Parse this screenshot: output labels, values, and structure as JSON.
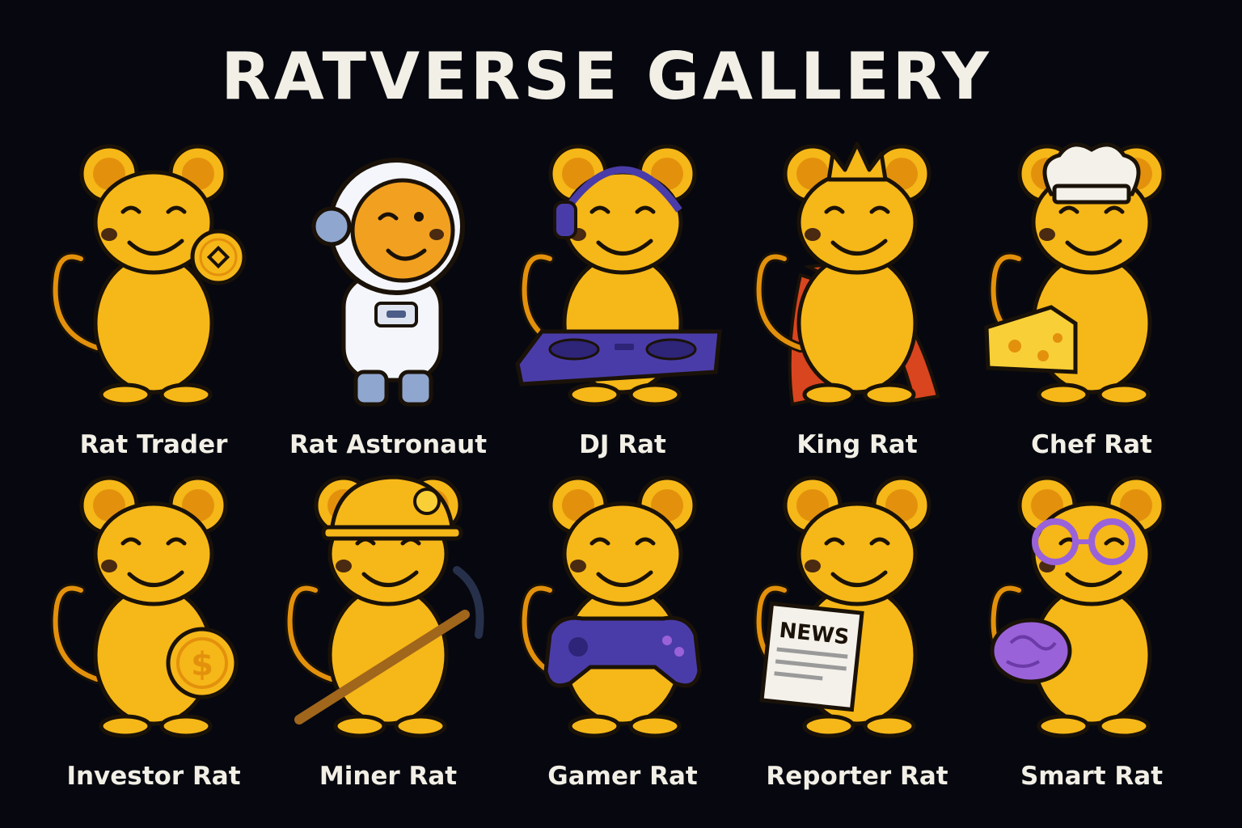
{
  "gallery": {
    "title": "RATVERSE GALLERY",
    "colors": {
      "background": "#07080f",
      "fur": "#f6b718",
      "fur_dark": "#e3910c",
      "outline": "#1a1208",
      "text": "#f2efe6",
      "purple": "#4a3ca8",
      "violet": "#9a62d8",
      "cape": "#d9451f"
    },
    "characters": [
      {
        "name": "Rat Trader",
        "icon": "coin-token-icon"
      },
      {
        "name": "Rat Astronaut",
        "icon": "astronaut-suit-icon"
      },
      {
        "name": "DJ Rat",
        "icon": "dj-turntable-icon"
      },
      {
        "name": "King Rat",
        "icon": "crown-icon"
      },
      {
        "name": "Chef Rat",
        "icon": "chef-hat-cheese-icon"
      },
      {
        "name": "Investor Rat",
        "icon": "dollar-coin-icon"
      },
      {
        "name": "Miner Rat",
        "icon": "pickaxe-helmet-icon"
      },
      {
        "name": "Gamer Rat",
        "icon": "gamepad-icon"
      },
      {
        "name": "Reporter Rat",
        "icon": "newspaper-icon"
      },
      {
        "name": "Smart Rat",
        "icon": "brain-glasses-icon"
      }
    ],
    "newspaper_text": "NEWS",
    "coin_symbol": "$"
  }
}
